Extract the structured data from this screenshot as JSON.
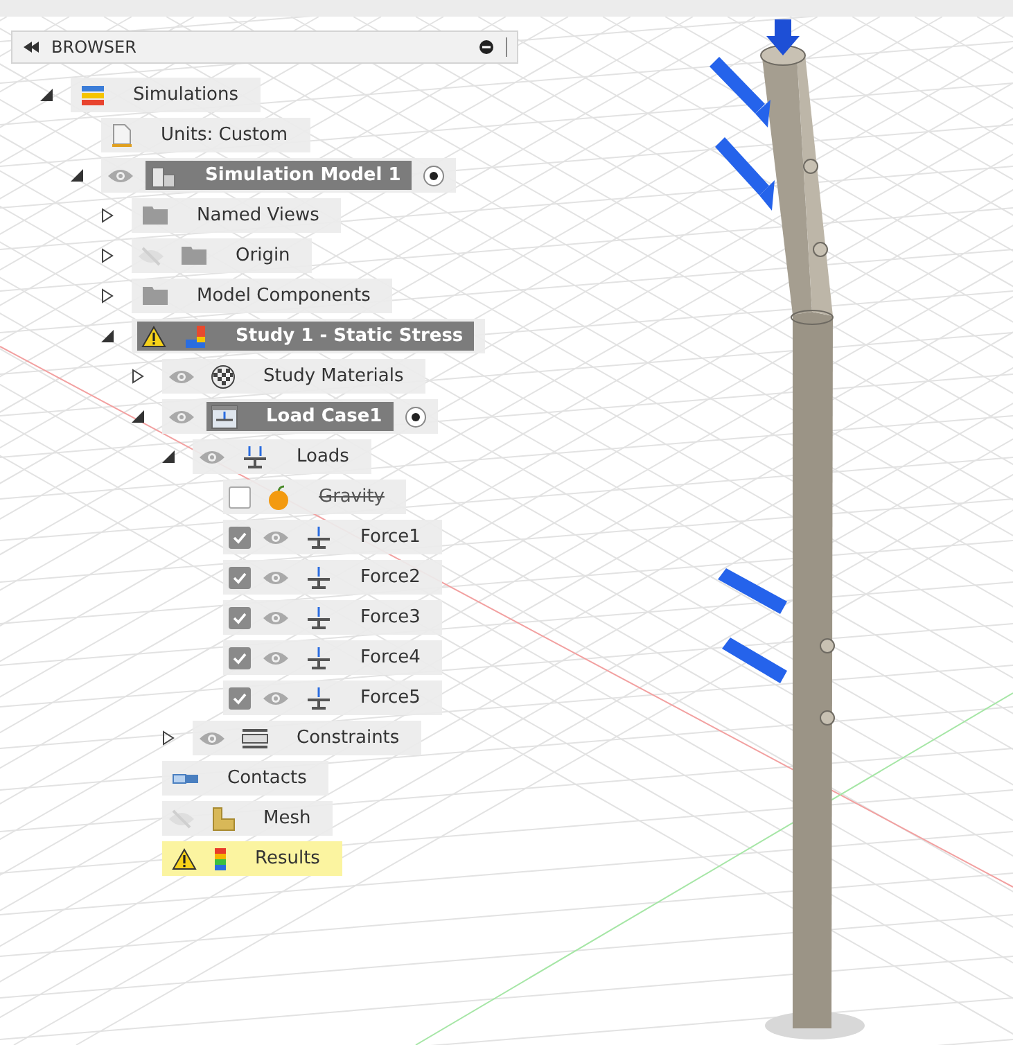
{
  "panel": {
    "title": "BROWSER"
  },
  "tree": [
    {
      "label": "Simulations",
      "kind": "simulations",
      "expanded": true,
      "selected": false,
      "children": [
        {
          "label": "Units: Custom",
          "kind": "document",
          "selected": false
        },
        {
          "label": "Simulation Model 1",
          "kind": "model",
          "expanded": true,
          "visible": true,
          "activated": true,
          "selected": true,
          "children": [
            {
              "label": "Named Views",
              "kind": "folder",
              "expanded": false,
              "selected": false
            },
            {
              "label": "Origin",
              "kind": "folder",
              "expanded": false,
              "visible": false,
              "selected": false
            },
            {
              "label": "Model Components",
              "kind": "folder",
              "expanded": false,
              "selected": false
            },
            {
              "label": "Study 1 - Static Stress",
              "kind": "study",
              "expanded": true,
              "warning": true,
              "selected": true,
              "children": [
                {
                  "label": "Study Materials",
                  "kind": "materials",
                  "expanded": false,
                  "visible": true,
                  "selected": false
                },
                {
                  "label": "Load Case1",
                  "kind": "loadcase",
                  "expanded": true,
                  "visible": true,
                  "activated": true,
                  "selected": true,
                  "children": [
                    {
                      "label": "Loads",
                      "kind": "loads",
                      "expanded": true,
                      "visible": true,
                      "selected": false,
                      "children": [
                        {
                          "label": "Gravity",
                          "kind": "gravity",
                          "checked": false,
                          "suppressed": true,
                          "selected": false
                        },
                        {
                          "label": "Force1",
                          "kind": "force",
                          "checked": true,
                          "visible": true,
                          "selected": false
                        },
                        {
                          "label": "Force2",
                          "kind": "force",
                          "checked": true,
                          "visible": true,
                          "selected": false
                        },
                        {
                          "label": "Force3",
                          "kind": "force",
                          "checked": true,
                          "visible": true,
                          "selected": false
                        },
                        {
                          "label": "Force4",
                          "kind": "force",
                          "checked": true,
                          "visible": true,
                          "selected": false
                        },
                        {
                          "label": "Force5",
                          "kind": "force",
                          "checked": true,
                          "visible": true,
                          "selected": false
                        }
                      ]
                    },
                    {
                      "label": "Constraints",
                      "kind": "constraints",
                      "expanded": false,
                      "visible": true,
                      "selected": false
                    }
                  ]
                },
                {
                  "label": "Contacts",
                  "kind": "contacts",
                  "selected": false
                },
                {
                  "label": "Mesh",
                  "kind": "mesh",
                  "visible": false,
                  "selected": false
                },
                {
                  "label": "Results",
                  "kind": "results",
                  "warning": true,
                  "selected": false
                }
              ]
            }
          ]
        }
      ]
    }
  ]
}
